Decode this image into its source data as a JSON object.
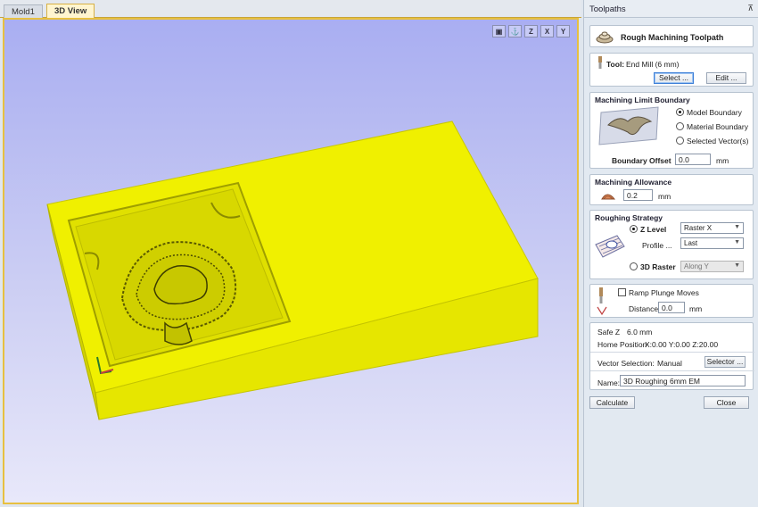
{
  "tabs": [
    {
      "label": "Mold1",
      "active": false
    },
    {
      "label": "3D View",
      "active": true
    }
  ],
  "view_icons": [
    "fit-view-icon",
    "iso-view-icon",
    "view-z-icon",
    "view-x-icon",
    "view-y-icon"
  ],
  "view_icon_labels": {
    "z": "Z",
    "x": "X",
    "y": "Y"
  },
  "panel": {
    "title": "Toolpaths",
    "pin_symbol": "⊼",
    "header": "Rough Machining Toolpath",
    "tool": {
      "label": "Tool:",
      "value": "End Mill (6 mm)",
      "select_label": "Select ...",
      "edit_label": "Edit ..."
    },
    "limit": {
      "heading": "Machining Limit Boundary",
      "options": [
        "Model Boundary",
        "Material Boundary",
        "Selected Vector(s)"
      ],
      "selected_index": 0,
      "offset_label": "Boundary Offset",
      "offset_value": "0.0",
      "unit": "mm"
    },
    "allowance": {
      "heading": "Machining Allowance",
      "value": "0.2",
      "unit": "mm"
    },
    "strategy": {
      "heading": "Roughing Strategy",
      "zlevel_label": "Z Level",
      "zlevel_selected": true,
      "zlevel_value": "Raster X",
      "profile_label": "Profile ...",
      "profile_value": "Last",
      "raster_label": "3D Raster",
      "raster_value": "Along Y"
    },
    "ramp": {
      "checkbox_label": "Ramp Plunge Moves",
      "checked": false,
      "distance_label": "Distance",
      "distance_value": "0.0",
      "unit": "mm"
    },
    "info": {
      "safe_z_label": "Safe Z",
      "safe_z_value": "6.0 mm",
      "home_label": "Home Position",
      "home_value": "X:0.00 Y:0.00 Z:20.00",
      "vector_label": "Vector Selection:",
      "vector_value": "Manual",
      "selector_label": "Selector ...",
      "name_label": "Name:",
      "name_value": "3D Roughing 6mm EM"
    },
    "calculate_label": "Calculate",
    "close_label": "Close"
  },
  "colors": {
    "model_yellow": "#e8e800",
    "viewport_border": "#e7c040",
    "accent_blue": "#3d7fd8"
  }
}
